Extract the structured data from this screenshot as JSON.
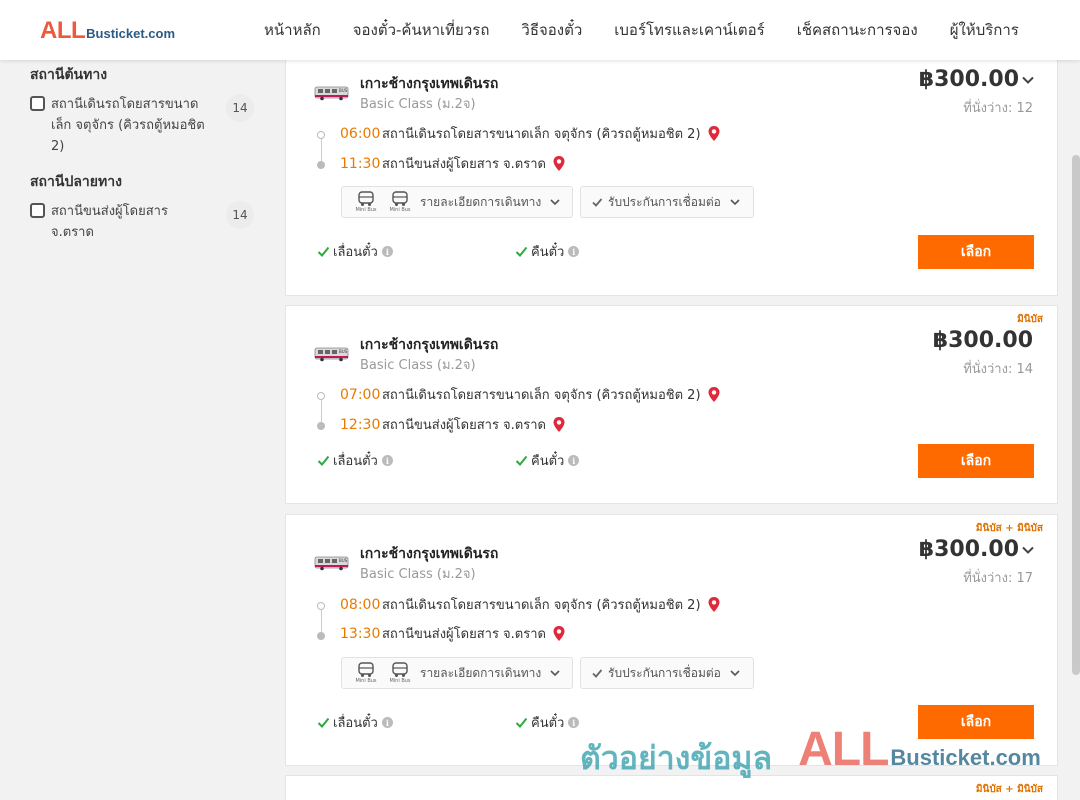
{
  "logo": {
    "brand_main": "ALL",
    "brand_rest": "Busticket.com"
  },
  "nav": [
    {
      "label": "หน้าหลัก"
    },
    {
      "label": "จองตั๋ว-ค้นหาเที่ยวรถ"
    },
    {
      "label": "วิธีจองตั๋ว"
    },
    {
      "label": "เบอร์โทรและเคาน์เตอร์"
    },
    {
      "label": "เช็คสถานะการจอง"
    },
    {
      "label": "ผู้ให้บริการ"
    }
  ],
  "sidebar": {
    "origin": {
      "title": "สถานีต้นทาง",
      "options": [
        {
          "label": "สถานีเดินรถโดยสารขนาดเล็ก จตุจักร (คิวรถตู้หมอชิต 2)",
          "count": "14",
          "checked": false
        }
      ]
    },
    "destination": {
      "title": "สถานีปลายทาง",
      "options": [
        {
          "label": "สถานีขนส่งผู้โดยสาร จ.ตราด",
          "count": "14",
          "checked": false
        }
      ]
    }
  },
  "trips": [
    {
      "tag": "",
      "operator": "เกาะช้างกรุงเทพเดินรถ",
      "class": "Basic Class (ม.2จ)",
      "price": "฿300.00",
      "seats": "ที่นั่งว่าง: 12",
      "depart_time": "06:00",
      "depart_station": "สถานีเดินรถโดยสารขนาดเล็ก จตุจักร (คิวรถตู้หมอชิต 2)",
      "arrive_time": "11:30",
      "arrive_station": "สถานีขนส่งผู้โดยสาร จ.ตราด",
      "bus_icon_label": "Mini Bus",
      "details_label": "รายละเอียดการเดินทาง",
      "guarantee_label": "รับประกันการเชื่อมต่อ",
      "feature1": "เลื่อนตั๋ว",
      "feature2": "คืนตั๋ว",
      "select_label": "เลือก"
    },
    {
      "tag": "มินิบัส",
      "operator": "เกาะช้างกรุงเทพเดินรถ",
      "class": "Basic Class (ม.2จ)",
      "price": "฿300.00",
      "seats": "ที่นั่งว่าง: 14",
      "depart_time": "07:00",
      "depart_station": "สถานีเดินรถโดยสารขนาดเล็ก จตุจักร (คิวรถตู้หมอชิต 2)",
      "arrive_time": "12:30",
      "arrive_station": "สถานีขนส่งผู้โดยสาร จ.ตราด",
      "feature1": "เลื่อนตั๋ว",
      "feature2": "คืนตั๋ว",
      "select_label": "เลือก"
    },
    {
      "tag": "มินิบัส + มินิบัส",
      "operator": "เกาะช้างกรุงเทพเดินรถ",
      "class": "Basic Class (ม.2จ)",
      "price": "฿300.00",
      "seats": "ที่นั่งว่าง: 17",
      "depart_time": "08:00",
      "depart_station": "สถานีเดินรถโดยสารขนาดเล็ก จตุจักร (คิวรถตู้หมอชิต 2)",
      "arrive_time": "13:30",
      "arrive_station": "สถานีขนส่งผู้โดยสาร จ.ตราด",
      "bus_icon_label": "Mini Bus",
      "details_label": "รายละเอียดการเดินทาง",
      "guarantee_label": "รับประกันการเชื่อมต่อ",
      "feature1": "เลื่อนตั๋ว",
      "feature2": "คืนตั๋ว",
      "select_label": "เลือก"
    },
    {
      "tag": "มินิบัส + มินิบัส"
    }
  ],
  "watermark": {
    "text": "ตัวอย่างข้อมูล",
    "brand_main": "ALL",
    "brand_rest": "Busticket.com"
  },
  "colors": {
    "accent_orange": "#ff6a00",
    "time_orange": "#e87a00",
    "tag_orange": "#e07200",
    "check_green": "#2eaa3c",
    "pin_red": "#e0283a",
    "brand_red": "#ec5a3d",
    "brand_blue": "#2d5a84"
  }
}
